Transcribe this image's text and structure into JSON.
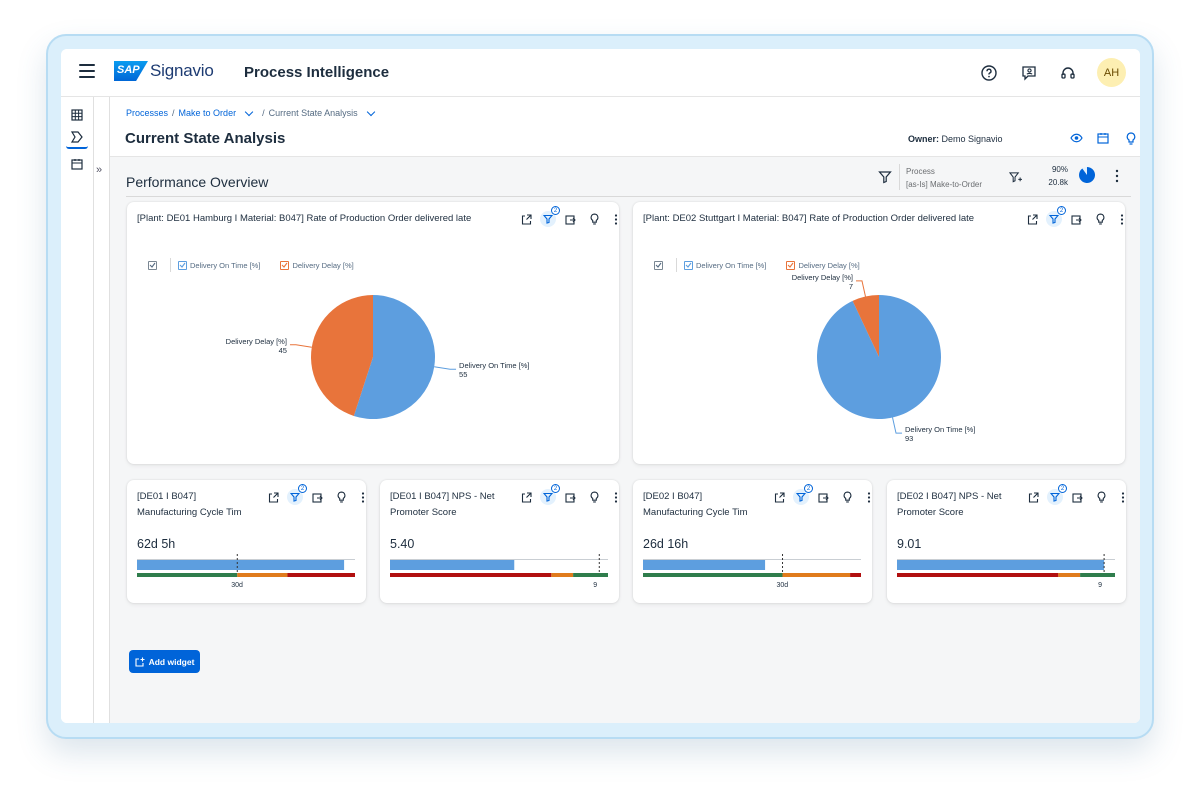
{
  "header": {
    "brand_mark": "SAP",
    "brand_name": "Signavio",
    "app_title": "Process Intelligence",
    "avatar_initials": "AH"
  },
  "breadcrumb": {
    "items": [
      "Processes",
      "Make to Order",
      "Current State Analysis"
    ]
  },
  "page": {
    "title": "Current State Analysis",
    "owner_label": "Owner:",
    "owner_name": "Demo Signavio"
  },
  "overview": {
    "title": "Performance Overview",
    "process_label": "Process",
    "process_name": "[as-Is] Make-to-Order",
    "coverage_pct": "90%",
    "case_count": "20.8k",
    "coverage_value": 0.9
  },
  "colors": {
    "on_time": "#5d9edf",
    "delay": "#e8743b",
    "green": "#2f7d4c",
    "orange": "#e07b1c",
    "red": "#b10f0f",
    "accent": "#0064d9"
  },
  "pie_widgets": [
    {
      "title": "[Plant: DE01 Hamburg I Material: B047] Rate of Production Order delivered late",
      "legend": [
        "Delivery On Time [%]",
        "Delivery Delay [%]"
      ],
      "filter_count": "2",
      "chart_data": {
        "type": "pie",
        "labels": [
          "Delivery On Time [%]",
          "Delivery Delay [%]"
        ],
        "values": [
          55,
          45
        ]
      }
    },
    {
      "title": "[Plant: DE02 Stuttgart I Material: B047] Rate of Production Order delivered late",
      "legend": [
        "Delivery On Time [%]",
        "Delivery Delay [%]"
      ],
      "filter_count": "2",
      "chart_data": {
        "type": "pie",
        "labels": [
          "Delivery On Time [%]",
          "Delivery Delay [%]"
        ],
        "values": [
          93,
          7
        ]
      }
    }
  ],
  "kpi_widgets": [
    {
      "title_line1": "[DE01 I B047]",
      "title_line2": "Manufacturing Cycle Tim",
      "value": "62d 5h",
      "target_label": "30d",
      "filter_count": "2",
      "actual_fraction": 0.95,
      "target_fraction": 0.46,
      "bands": [
        [
          "green",
          0.46
        ],
        [
          "orange",
          0.23
        ],
        [
          "red",
          0.31
        ]
      ]
    },
    {
      "title_line1": "[DE01 I B047] NPS - Net",
      "title_line2": "Promoter Score",
      "value": "5.40",
      "target_label": "9",
      "filter_count": "2",
      "actual_fraction": 0.57,
      "target_fraction": 0.96,
      "bands": [
        [
          "red",
          0.74
        ],
        [
          "orange",
          0.1
        ],
        [
          "green",
          0.16
        ]
      ]
    },
    {
      "title_line1": "[DE02 I B047]",
      "title_line2": "Manufacturing Cycle Tim",
      "value": "26d 16h",
      "target_label": "30d",
      "filter_count": "2",
      "actual_fraction": 0.56,
      "target_fraction": 0.64,
      "bands": [
        [
          "green",
          0.64
        ],
        [
          "orange",
          0.31
        ],
        [
          "red",
          0.05
        ]
      ]
    },
    {
      "title_line1": "[DE02 I B047] NPS - Net",
      "title_line2": "Promoter Score",
      "value": "9.01",
      "target_label": "9",
      "filter_count": "2",
      "actual_fraction": 0.95,
      "target_fraction": 0.95,
      "bands": [
        [
          "red",
          0.74
        ],
        [
          "orange",
          0.1
        ],
        [
          "green",
          0.16
        ]
      ]
    }
  ],
  "add_widget_label": "Add widget"
}
